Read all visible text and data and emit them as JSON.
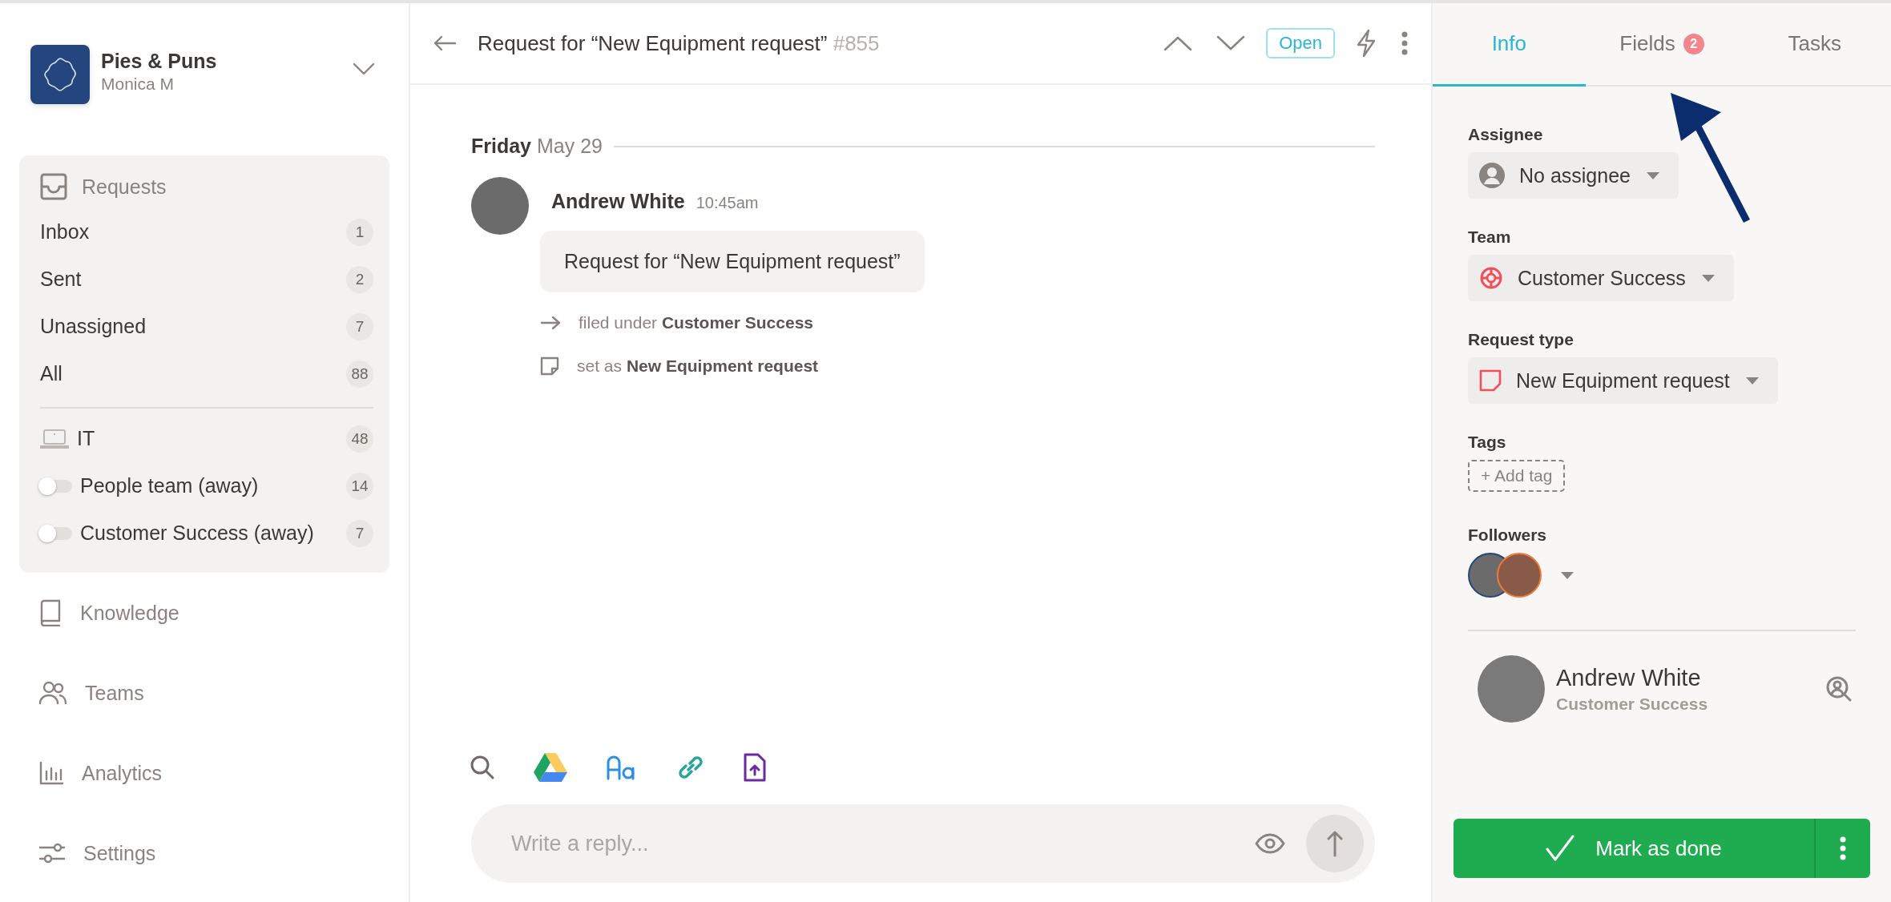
{
  "workspace": {
    "name": "Pies & Puns",
    "user": "Monica M"
  },
  "requests": {
    "title": "Requests",
    "items": [
      {
        "label": "Inbox",
        "count": "1",
        "selected": false
      },
      {
        "label": "Sent",
        "count": "2",
        "selected": false
      },
      {
        "label": "Unassigned",
        "count": "7",
        "selected": false
      },
      {
        "label": "All",
        "count": "88",
        "selected": false
      }
    ],
    "teams": [
      {
        "kind": "team",
        "label": "IT",
        "count": "48"
      },
      {
        "kind": "toggle",
        "label": "People team (away)",
        "count": "14",
        "on": false
      },
      {
        "kind": "toggle",
        "label": "Customer Success (away)",
        "count": "7",
        "on": false
      }
    ]
  },
  "nav": [
    {
      "kind": "knowledge",
      "label": "Knowledge"
    },
    {
      "kind": "teams",
      "label": "Teams"
    },
    {
      "kind": "analytics",
      "label": "Analytics"
    },
    {
      "kind": "settings",
      "label": "Settings"
    }
  ],
  "header": {
    "title": "Request for “New Equipment request”",
    "number": "#855",
    "status": "Open"
  },
  "conversation": {
    "day": "Friday",
    "date": "May 29",
    "author": "Andrew White",
    "time": "10:45am",
    "message": "Request for “New Equipment request”",
    "events": [
      {
        "kind": "filed",
        "text": "filed under **Customer Success**"
      },
      {
        "kind": "type",
        "text": "set as **New Equipment request**"
      }
    ]
  },
  "composer": {
    "placeholder": "Write a reply..."
  },
  "tabs": [
    {
      "label": "Info",
      "selected": true
    },
    {
      "label": "Fields",
      "badge": "2",
      "selected": false
    },
    {
      "label": "Tasks",
      "selected": false
    }
  ],
  "fields": [
    {
      "kind": "assignee",
      "label": "Assignee",
      "value": "No assignee"
    },
    {
      "kind": "team",
      "label": "Team",
      "value": "Customer Success"
    },
    {
      "kind": "type",
      "label": "Request type",
      "value": "New Equipment request"
    }
  ],
  "tags": {
    "label": "Tags",
    "add": "+ Add tag"
  },
  "followers": {
    "label": "Followers"
  },
  "requester": {
    "name": "Andrew White",
    "team": "Customer Success"
  },
  "done_button": "Mark as done"
}
